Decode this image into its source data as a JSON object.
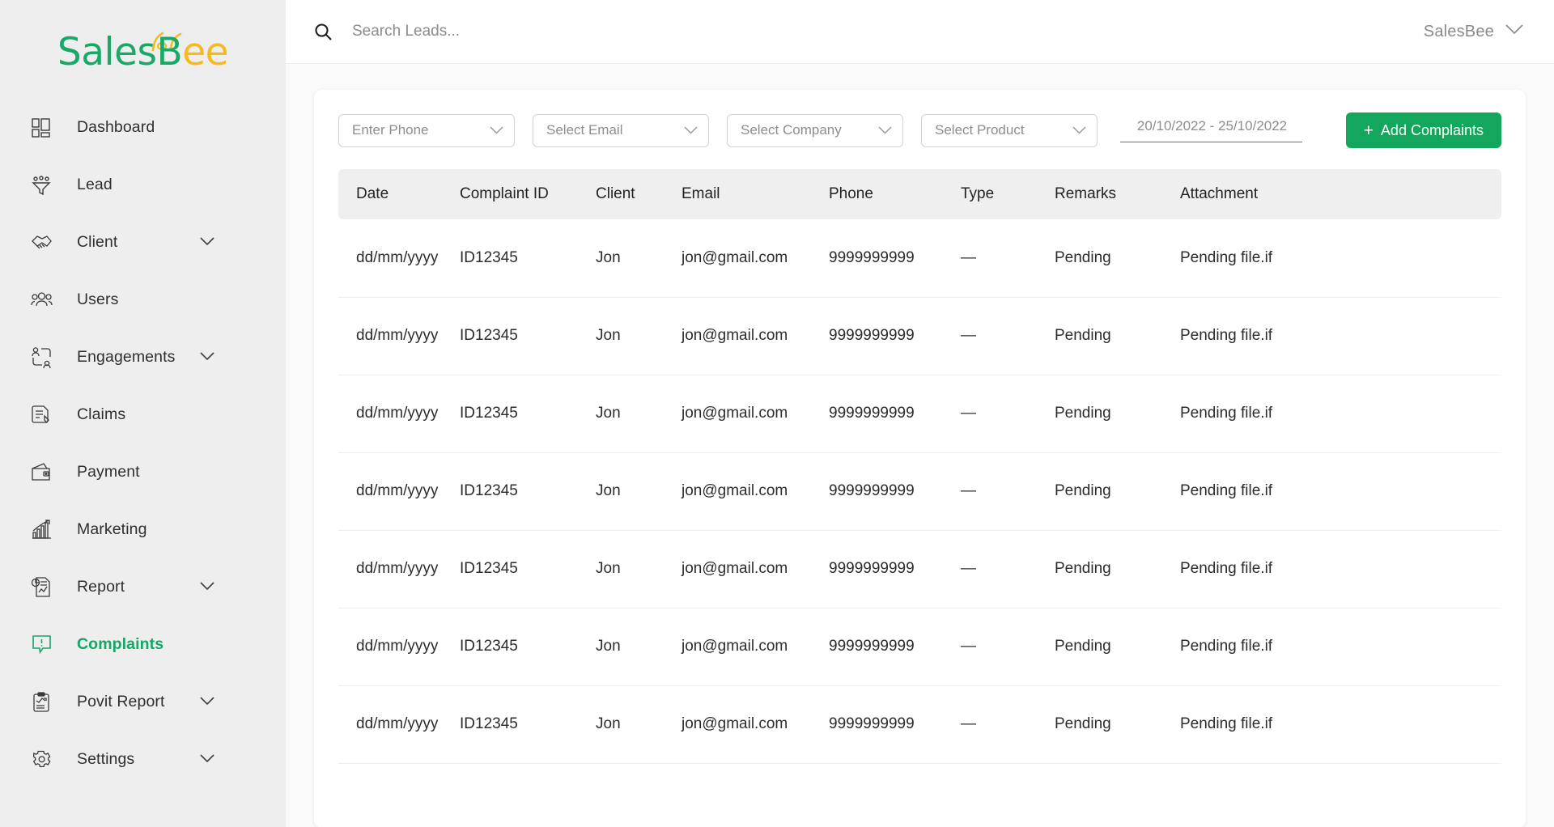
{
  "brand": {
    "logo_sales": "Sales",
    "logo_b": "B",
    "logo_ee": "ee",
    "accent_green": "#1aa867",
    "accent_yellow": "#f5b922",
    "button_green": "#13a65d"
  },
  "sidebar": {
    "items": [
      {
        "label": "Dashboard",
        "icon": "dashboard-icon",
        "chevron": false,
        "active": false
      },
      {
        "label": "Lead",
        "icon": "funnel-icon",
        "chevron": false,
        "active": false
      },
      {
        "label": "Client",
        "icon": "handshake-icon",
        "chevron": true,
        "active": false
      },
      {
        "label": "Users",
        "icon": "users-icon",
        "chevron": false,
        "active": false
      },
      {
        "label": "Engagements",
        "icon": "engagements-icon",
        "chevron": true,
        "active": false
      },
      {
        "label": "Claims",
        "icon": "claims-icon",
        "chevron": false,
        "active": false
      },
      {
        "label": "Payment",
        "icon": "wallet-icon",
        "chevron": false,
        "active": false
      },
      {
        "label": "Marketing",
        "icon": "bar-chart-icon",
        "chevron": false,
        "active": false
      },
      {
        "label": "Report",
        "icon": "report-icon",
        "chevron": true,
        "active": false
      },
      {
        "label": "Complaints",
        "icon": "complaint-icon",
        "chevron": false,
        "active": true
      },
      {
        "label": "Povit Report",
        "icon": "clipboard-icon",
        "chevron": true,
        "active": false
      },
      {
        "label": "Settings",
        "icon": "gear-icon",
        "chevron": true,
        "active": false
      }
    ]
  },
  "topbar": {
    "search_placeholder": "Search Leads...",
    "search_value": "",
    "search_icon": "search-icon",
    "user_name": "SalesBee",
    "user_chevron": "chevron-down-icon"
  },
  "filters": {
    "selects": [
      {
        "label": "Enter Phone",
        "name": "phone-filter"
      },
      {
        "label": "Select Email",
        "name": "email-filter"
      },
      {
        "label": "Select Company",
        "name": "company-filter"
      },
      {
        "label": "Select Product",
        "name": "product-filter"
      }
    ],
    "date_range": "20/10/2022 - 25/10/2022",
    "add_button": "Add Complaints",
    "add_button_plus": "+"
  },
  "table": {
    "columns": [
      "Date",
      "Complaint ID",
      "Client",
      "Email",
      "Phone",
      "Type",
      "Remarks",
      "Attachment"
    ],
    "rows": [
      {
        "date": "dd/mm/yyyy",
        "complaint_id": "ID12345",
        "client": "Jon",
        "email": "jon@gmail.com",
        "phone": "9999999999",
        "type": "—",
        "remarks": "Pending",
        "attachment": "Pending file.if"
      },
      {
        "date": "dd/mm/yyyy",
        "complaint_id": "ID12345",
        "client": "Jon",
        "email": "jon@gmail.com",
        "phone": "9999999999",
        "type": "—",
        "remarks": "Pending",
        "attachment": "Pending file.if"
      },
      {
        "date": "dd/mm/yyyy",
        "complaint_id": "ID12345",
        "client": "Jon",
        "email": "jon@gmail.com",
        "phone": "9999999999",
        "type": "—",
        "remarks": "Pending",
        "attachment": "Pending file.if"
      },
      {
        "date": "dd/mm/yyyy",
        "complaint_id": "ID12345",
        "client": "Jon",
        "email": "jon@gmail.com",
        "phone": "9999999999",
        "type": "—",
        "remarks": "Pending",
        "attachment": "Pending file.if"
      },
      {
        "date": "dd/mm/yyyy",
        "complaint_id": "ID12345",
        "client": "Jon",
        "email": "jon@gmail.com",
        "phone": "9999999999",
        "type": "—",
        "remarks": "Pending",
        "attachment": "Pending file.if"
      },
      {
        "date": "dd/mm/yyyy",
        "complaint_id": "ID12345",
        "client": "Jon",
        "email": "jon@gmail.com",
        "phone": "9999999999",
        "type": "—",
        "remarks": "Pending",
        "attachment": "Pending file.if"
      },
      {
        "date": "dd/mm/yyyy",
        "complaint_id": "ID12345",
        "client": "Jon",
        "email": "jon@gmail.com",
        "phone": "9999999999",
        "type": "—",
        "remarks": "Pending",
        "attachment": "Pending file.if"
      }
    ]
  }
}
